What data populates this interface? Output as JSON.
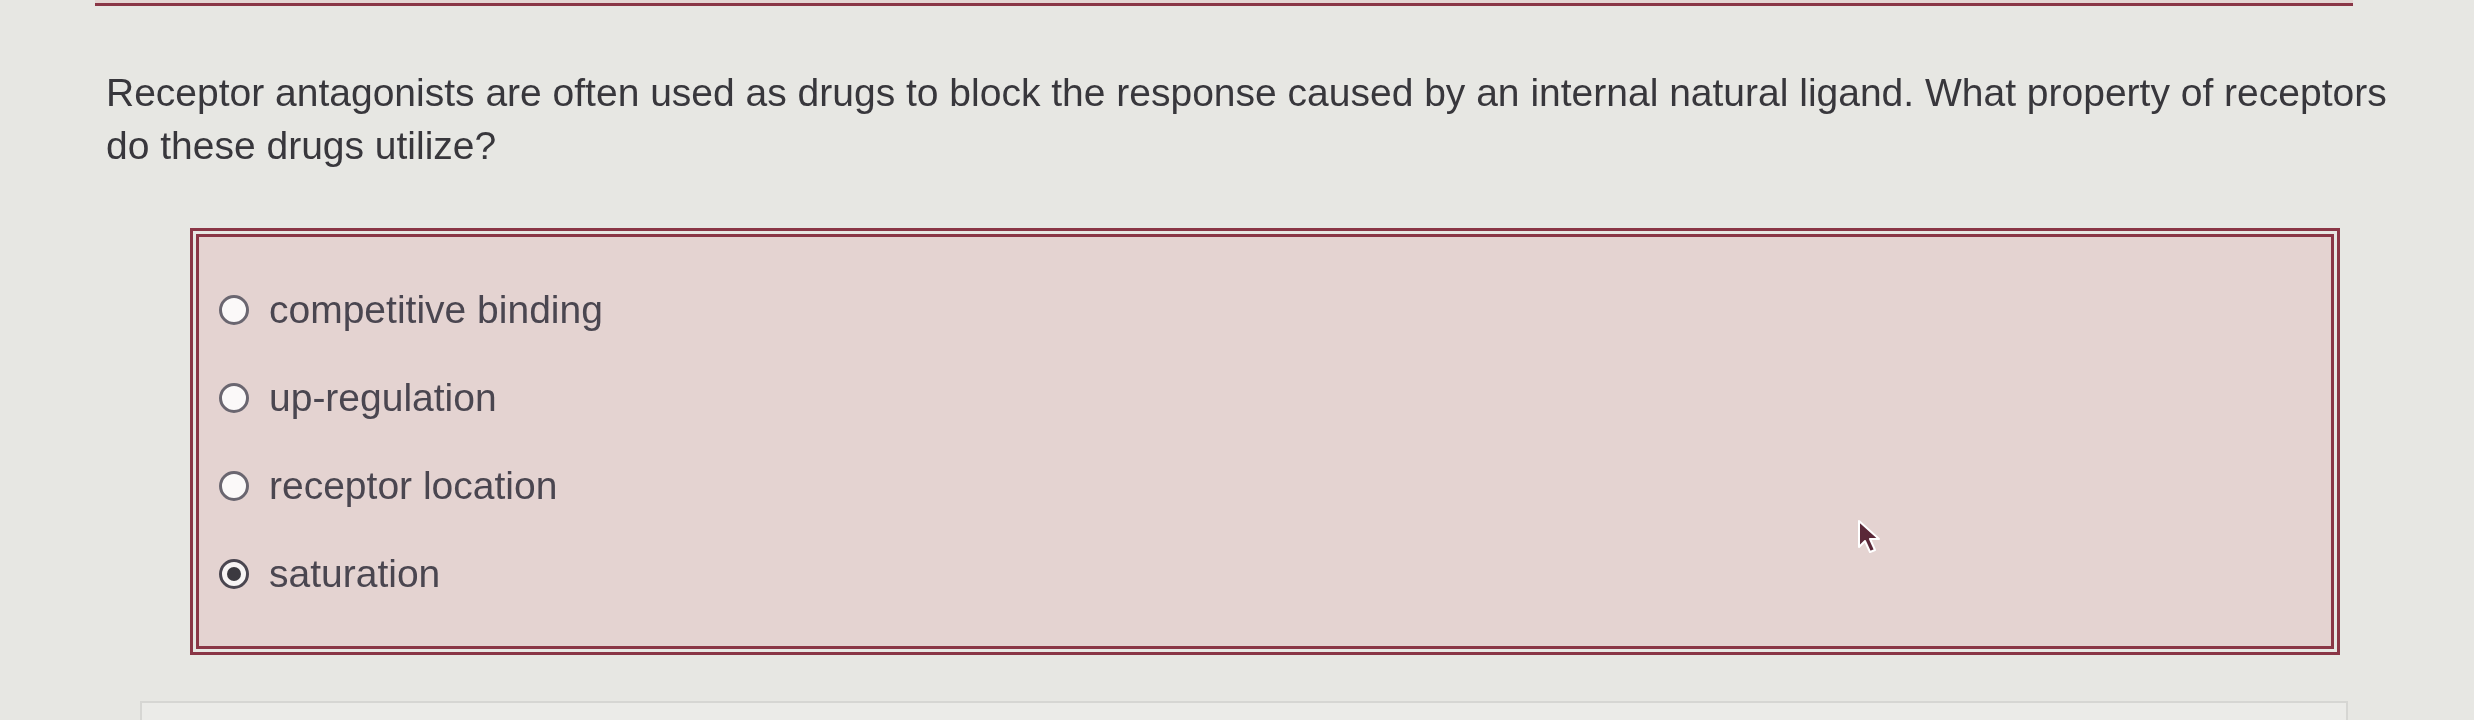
{
  "question": {
    "text": "Receptor antagonists are often used as drugs to block the response caused by an internal natural ligand. What property of receptors do these drugs utilize?"
  },
  "options": [
    {
      "label": "competitive binding",
      "selected": false
    },
    {
      "label": "up-regulation",
      "selected": false
    },
    {
      "label": "receptor location",
      "selected": false
    },
    {
      "label": "saturation",
      "selected": true
    }
  ]
}
